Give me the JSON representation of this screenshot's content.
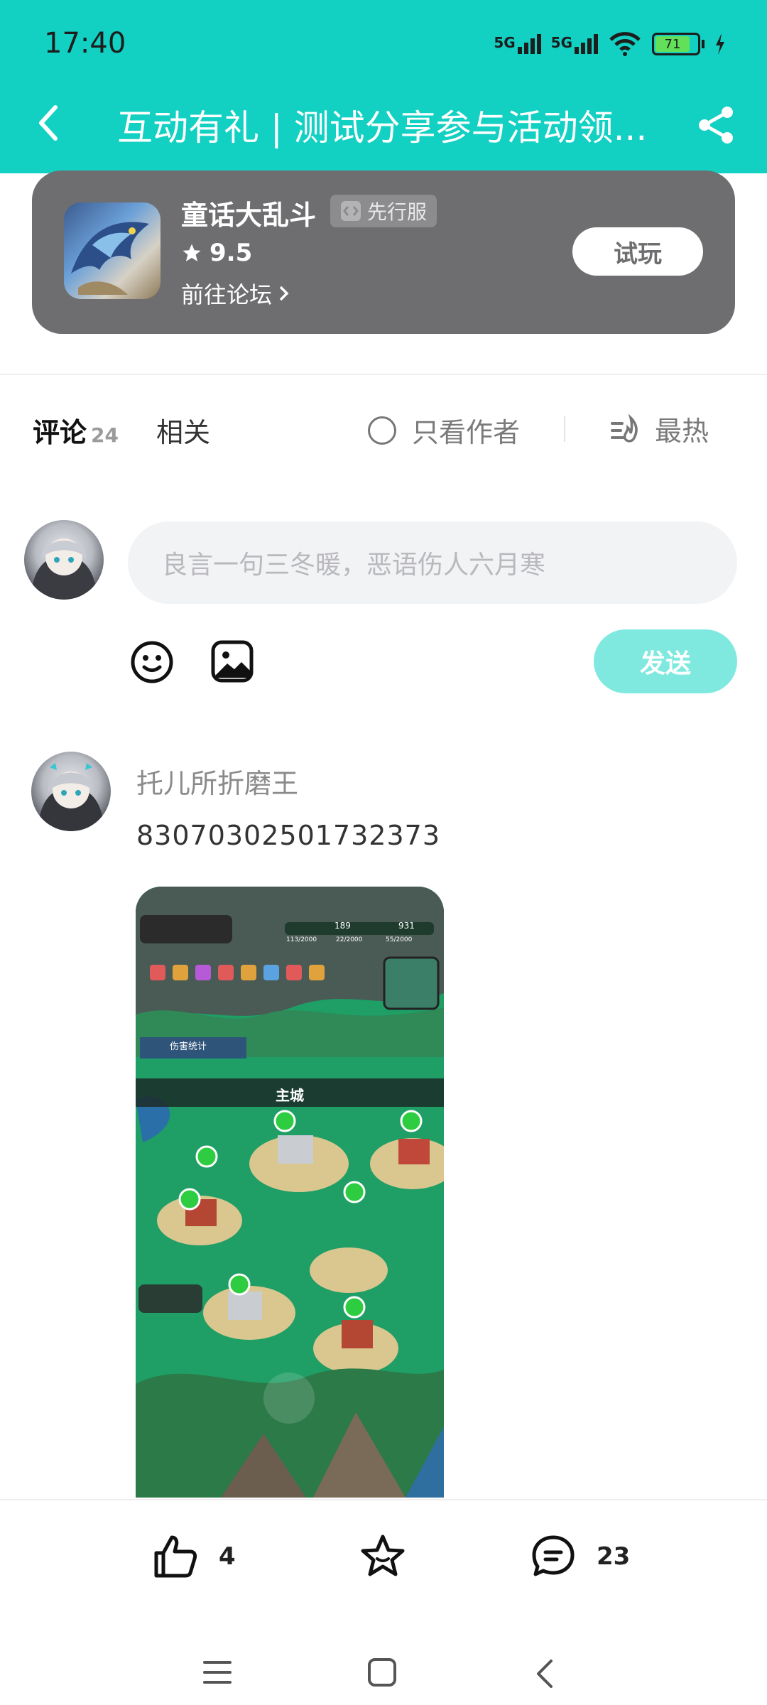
{
  "status_bar": {
    "time": "17:40",
    "signal_1_label": "5G",
    "signal_2_label": "5G",
    "battery_level": "71"
  },
  "nav": {
    "title": "互动有礼 | 测试分享参与活动领...",
    "back_icon": "chevron-left-icon",
    "share_icon": "share-icon"
  },
  "game_card": {
    "name": "童话大乱斗",
    "tag": "先行服",
    "rating": "9.5",
    "forum_link": "前往论坛",
    "try_button": "试玩"
  },
  "tabs": {
    "comments_label": "评论",
    "comments_count": "24",
    "related_label": "相关",
    "author_only_label": "只看作者",
    "sort_label": "最热"
  },
  "composer": {
    "placeholder": "良言一句三冬暖，恶语伤人六月寒",
    "send_button": "发送"
  },
  "comment": {
    "username": "托儿所折磨王",
    "text": "83070302501732373",
    "screenshot_label": "主城",
    "screenshot_panel_label": "伤害统计",
    "screenshot_stats": [
      "189",
      "931",
      "113/2000",
      "22/2000",
      "55/2000"
    ]
  },
  "bottom_actions": {
    "like_count": "4",
    "comment_count": "23"
  },
  "colors": {
    "accent": "#12d0c2",
    "send_button": "#7fe9e0",
    "card_bg": "#6e6e70"
  }
}
